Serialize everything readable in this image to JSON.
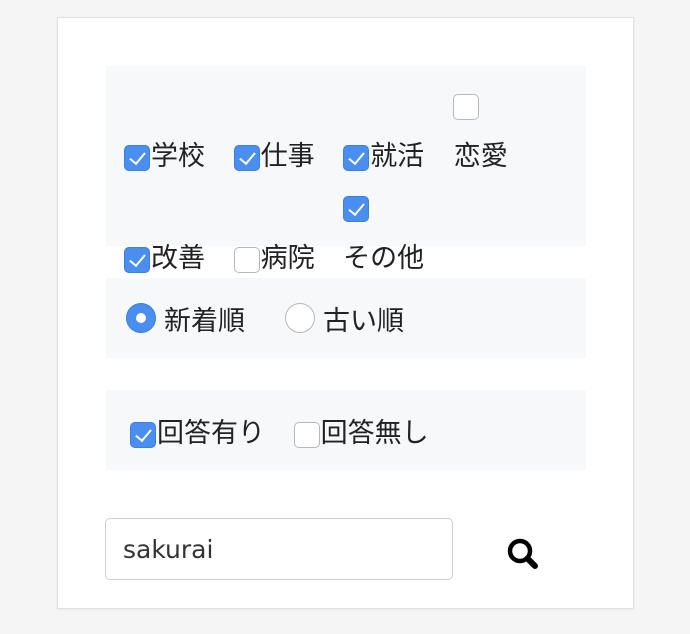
{
  "categories": [
    {
      "label": "学校",
      "checked": true
    },
    {
      "label": "仕事",
      "checked": true
    },
    {
      "label": "就活",
      "checked": true
    },
    {
      "label": "恋愛",
      "checked": false
    },
    {
      "label": "改善",
      "checked": true
    },
    {
      "label": "病院",
      "checked": false
    },
    {
      "label": "その他",
      "checked": true
    }
  ],
  "sort": {
    "options": [
      {
        "label": "新着順",
        "selected": true
      },
      {
        "label": "古い順",
        "selected": false
      }
    ]
  },
  "answer_filter": [
    {
      "label": "回答有り",
      "checked": true
    },
    {
      "label": "回答無し",
      "checked": false
    }
  ],
  "search": {
    "value": "sakurai",
    "icon": "search-icon"
  },
  "colors": {
    "accent": "#4a8ff0",
    "panel_bg": "#f7f8fa",
    "page_bg": "#f5f5f5"
  }
}
